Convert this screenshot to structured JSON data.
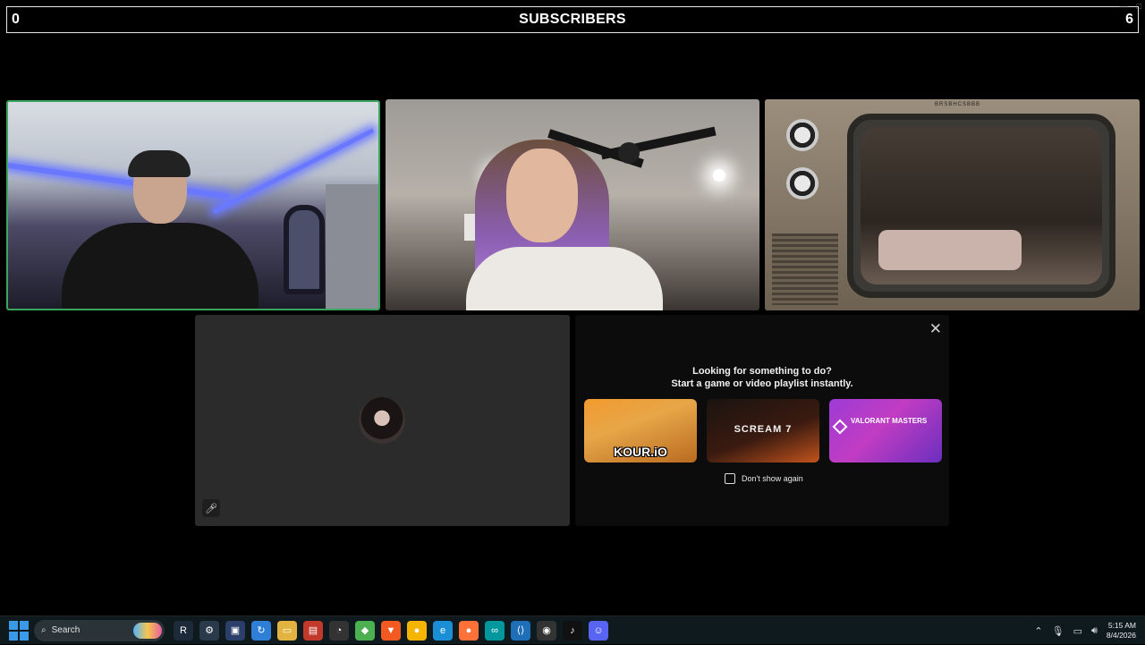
{
  "scoreboard": {
    "left_count": "0",
    "title": "SUBSCRIBERS",
    "right_count": "6"
  },
  "panel": {
    "line1": "Looking for something to do?",
    "line2": "Start a game or video playlist instantly.",
    "cards": [
      {
        "label": "KOUR.iO"
      },
      {
        "label": "SCREAM 7"
      },
      {
        "label": "VALORANT MASTERS"
      }
    ],
    "dont_show_label": "Don't show again"
  },
  "tv": {
    "brand": "BRSBHCSBBB"
  },
  "taskbar": {
    "search_placeholder": "Search",
    "time": "5:15 AM",
    "date": "8/4/2026",
    "icons": [
      "terminal-icon",
      "network-icon",
      "monitor-icon",
      "remote-icon",
      "folder-icon",
      "video-editor-icon",
      "timer-icon",
      "shield-icon",
      "brave-icon",
      "chrome-icon",
      "edge-icon",
      "firefox-icon",
      "arduino-icon",
      "vscode-icon",
      "obs-icon",
      "tiktok-icon",
      "discord-icon"
    ]
  },
  "colors": {
    "speaking_border": "#3ba55d",
    "taskbar_bg": "#0f1a1f",
    "panel_bg": "#0c0c0c"
  }
}
